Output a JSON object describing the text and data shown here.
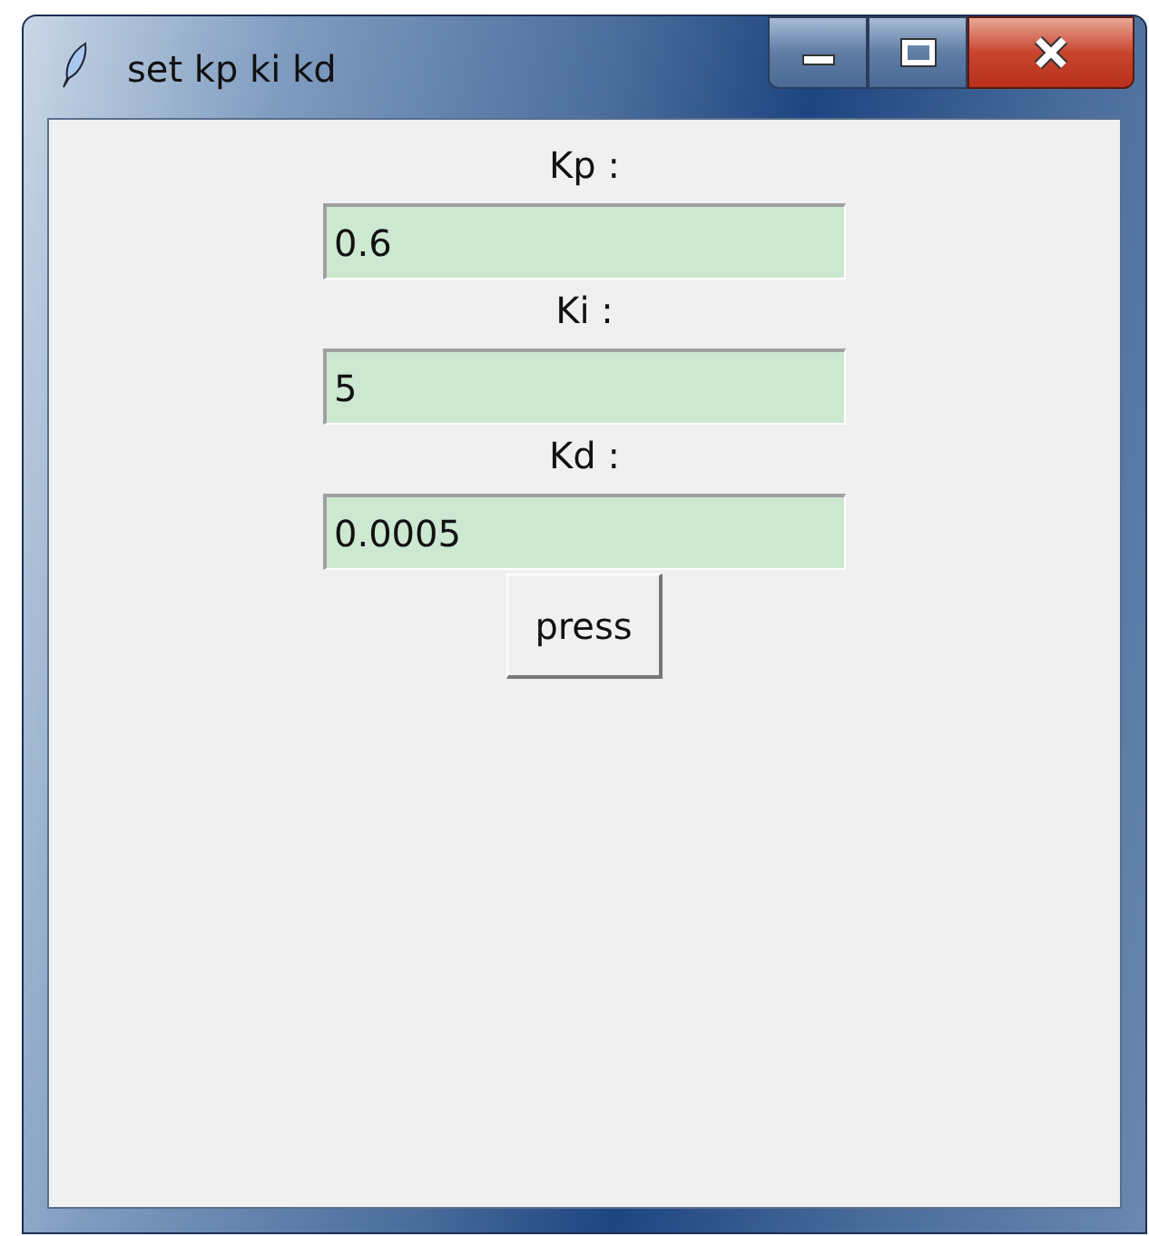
{
  "window": {
    "title": "set kp ki kd"
  },
  "fields": [
    {
      "label": "Kp :",
      "value": "0.6"
    },
    {
      "label": "Ki :",
      "value": "5"
    },
    {
      "label": "Kd :",
      "value": "0.0005"
    }
  ],
  "button": {
    "label": "press"
  }
}
